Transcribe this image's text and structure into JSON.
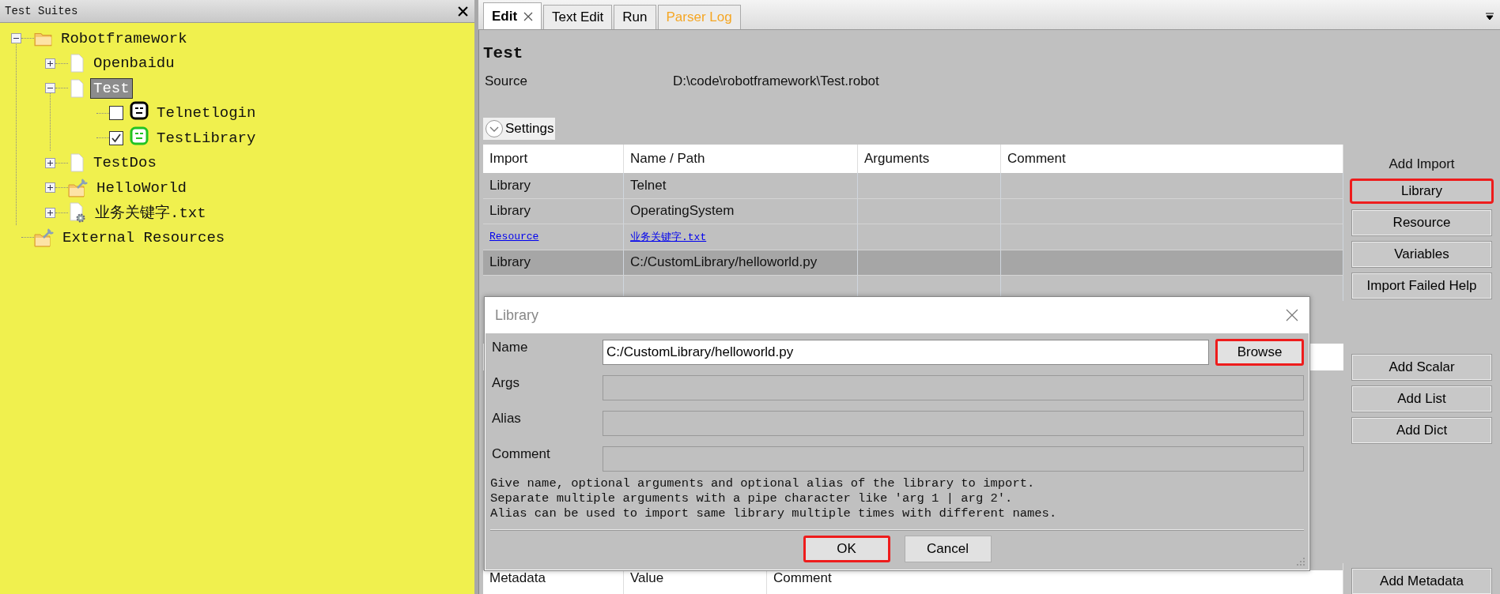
{
  "left_panel": {
    "title": "Test Suites",
    "tree": [
      {
        "label": "Robotframework",
        "kind": "folder",
        "expanded": true,
        "selected": false,
        "children": [
          {
            "label": "Openbaidu",
            "kind": "file",
            "expanded": false,
            "selected": false
          },
          {
            "label": "Test",
            "kind": "file",
            "expanded": true,
            "selected": true,
            "children": [
              {
                "label": "Telnetlogin",
                "kind": "test",
                "checked": false,
                "color": "#000000",
                "selected": false
              },
              {
                "label": "TestLibrary",
                "kind": "test",
                "checked": true,
                "color": "#22c322",
                "selected": false
              }
            ]
          },
          {
            "label": "TestDos",
            "kind": "file",
            "expanded": false,
            "selected": false
          },
          {
            "label": "HelloWorld",
            "kind": "resource_folder",
            "expanded": false,
            "selected": false
          },
          {
            "label": "业务关键字.txt",
            "kind": "resource_file",
            "expanded": false,
            "selected": false
          }
        ]
      },
      {
        "label": "External Resources",
        "kind": "resource_folder",
        "selected": false
      }
    ]
  },
  "tabs": [
    {
      "label": "Edit",
      "selected": true,
      "closable": true,
      "color": "#000000"
    },
    {
      "label": "Text Edit",
      "selected": false,
      "closable": false,
      "color": "#000000"
    },
    {
      "label": "Run",
      "selected": false,
      "closable": false,
      "color": "#000000"
    },
    {
      "label": "Parser Log",
      "selected": false,
      "closable": false,
      "color": "#f5a623"
    }
  ],
  "editor": {
    "title": "Test",
    "source_label": "Source",
    "source_value": "D:\\code\\robotframework\\Test.robot",
    "settings_label": "Settings"
  },
  "imports_table": {
    "columns": [
      "Import",
      "Name / Path",
      "Arguments",
      "Comment"
    ],
    "rows": [
      {
        "cells": [
          "Library",
          "Telnet"
        ],
        "link": false,
        "selected": false
      },
      {
        "cells": [
          "Library",
          "OperatingSystem"
        ],
        "link": false,
        "selected": false
      },
      {
        "cells": [
          "Resource",
          "业务关键字.txt"
        ],
        "link": true,
        "selected": false
      },
      {
        "cells": [
          "Library",
          "C:/CustomLibrary/helloworld.py"
        ],
        "link": false,
        "selected": true
      }
    ]
  },
  "side_buttons": {
    "heading": "Add Import",
    "import_buttons": [
      {
        "label": "Library",
        "highlighted": true
      },
      {
        "label": "Resource",
        "highlighted": false
      },
      {
        "label": "Variables",
        "highlighted": false
      },
      {
        "label": "Import Failed Help",
        "highlighted": false
      }
    ],
    "variable_buttons": [
      {
        "label": "Add Scalar",
        "highlighted": false
      },
      {
        "label": "Add List",
        "highlighted": false
      },
      {
        "label": "Add Dict",
        "highlighted": false
      }
    ],
    "metadata_button": {
      "label": "Add Metadata",
      "highlighted": false
    }
  },
  "metadata_table": {
    "columns": [
      "Metadata",
      "Value",
      "Comment"
    ]
  },
  "dialog": {
    "title": "Library",
    "fields": [
      {
        "label": "Name",
        "value": "C:/CustomLibrary/helloworld.py",
        "disabled": false
      },
      {
        "label": "Args",
        "disabled": true
      },
      {
        "label": "Alias",
        "disabled": true
      },
      {
        "label": "Comment",
        "disabled": true
      }
    ],
    "browse": {
      "label": "Browse",
      "highlighted": true
    },
    "help_lines": [
      "Give name, optional arguments and optional alias of the library to import.",
      "Separate multiple arguments with a pipe character like 'arg 1 | arg 2'.",
      "Alias can be used to import same library multiple times with different names."
    ],
    "buttons": [
      {
        "label": "OK",
        "highlighted": true
      },
      {
        "label": "Cancel",
        "highlighted": false
      }
    ]
  }
}
